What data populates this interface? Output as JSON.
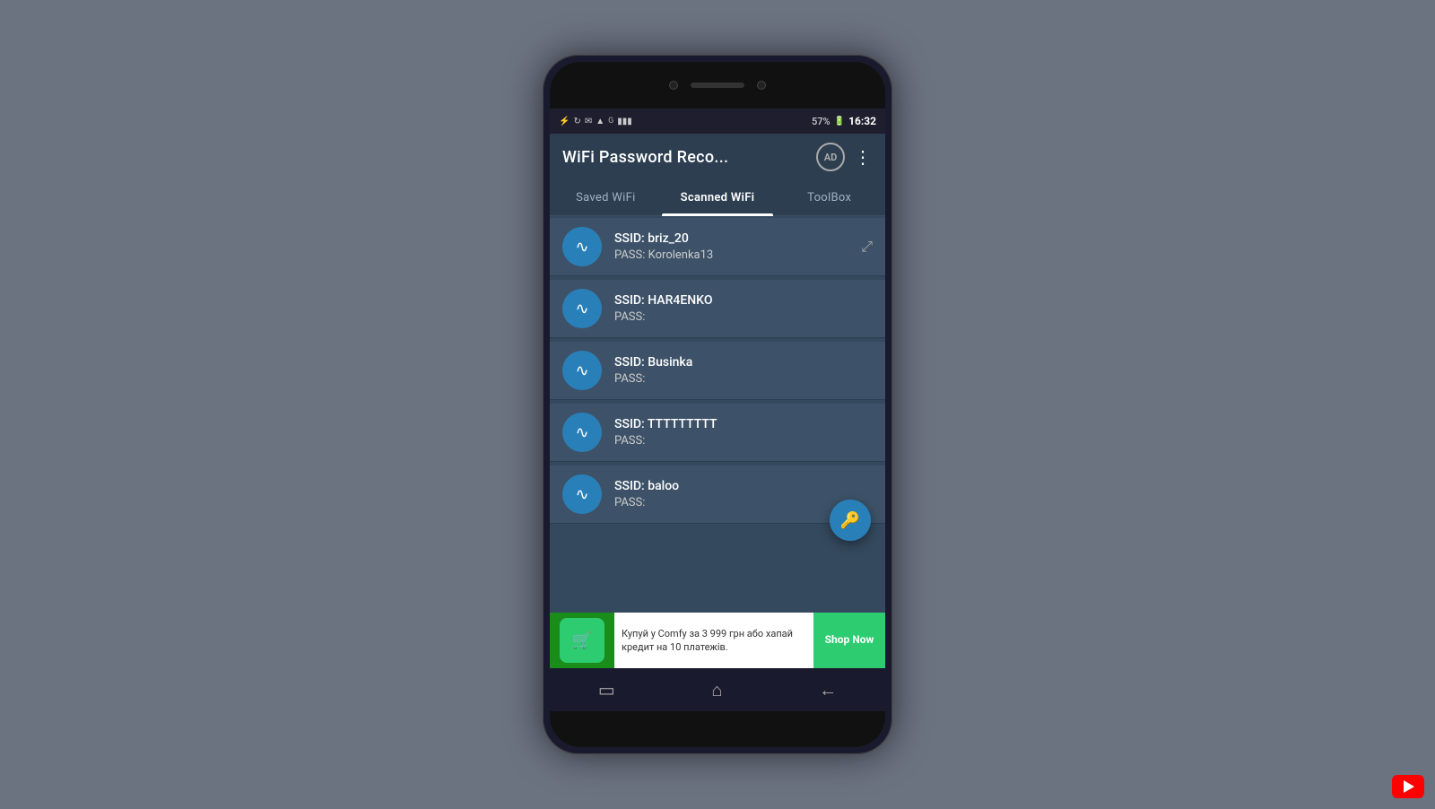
{
  "background": {
    "color": "#6b7280"
  },
  "statusBar": {
    "time": "16:32",
    "battery": "57%",
    "icons": [
      "usb",
      "sync",
      "mail",
      "wifi",
      "G",
      "signal",
      "G",
      "signal"
    ]
  },
  "appHeader": {
    "title": "WiFi Password Reco...",
    "adBadge": "AD",
    "moreIcon": "⋮"
  },
  "tabs": [
    {
      "id": "saved",
      "label": "Saved WiFi",
      "active": false
    },
    {
      "id": "scanned",
      "label": "Scanned WiFi",
      "active": true
    },
    {
      "id": "toolbox",
      "label": "ToolBox",
      "active": false
    }
  ],
  "networks": [
    {
      "ssid_label": "SSID:",
      "ssid_value": "briz_20",
      "pass_label": "PASS:",
      "pass_value": "Korolenka13",
      "has_share": true
    },
    {
      "ssid_label": "SSID:",
      "ssid_value": "HAR4ENKO",
      "pass_label": "PASS:",
      "pass_value": "",
      "has_share": false
    },
    {
      "ssid_label": "SSID:",
      "ssid_value": "Businka",
      "pass_label": "PASS:",
      "pass_value": "",
      "has_share": false
    },
    {
      "ssid_label": "SSID:",
      "ssid_value": "TTTTTTTTT",
      "pass_label": "PASS:",
      "pass_value": "",
      "has_share": false
    },
    {
      "ssid_label": "SSID:",
      "ssid_value": "baloo",
      "pass_label": "PASS:",
      "pass_value": "",
      "has_share": false
    }
  ],
  "fab": {
    "icon": "🔑"
  },
  "adBanner": {
    "logo": "🛒",
    "brandName": "COMFY",
    "text": "Купуй у Comfy за 3 999 грн або хапай кредит на 10 платежів.",
    "cta": "Shop Now"
  },
  "bottomNav": {
    "icons": [
      "▭",
      "⌂",
      "←"
    ]
  }
}
